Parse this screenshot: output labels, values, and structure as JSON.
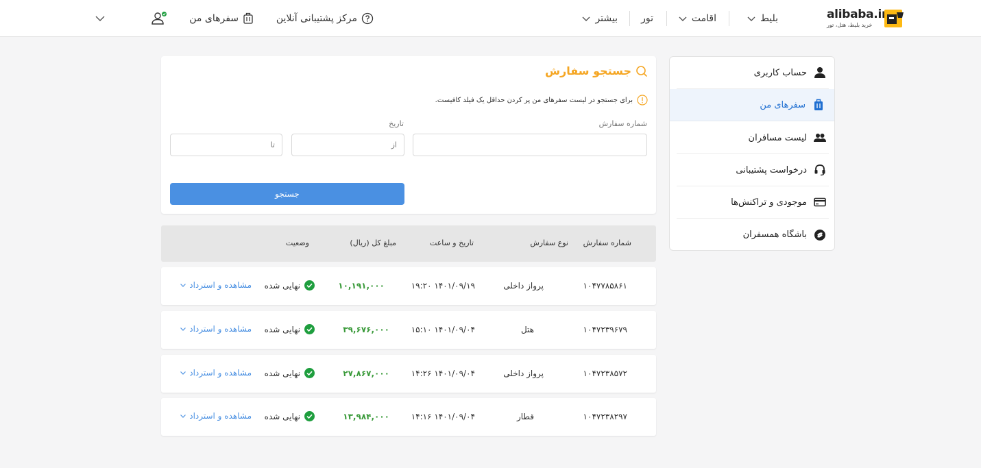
{
  "header": {
    "logo_text": "alibaba.ir",
    "logo_sub": "خرید بلیط، هتل، تور",
    "nav": {
      "ticket": "بلیط",
      "stay": "اقامت",
      "tour": "تور",
      "more": "بیشتر",
      "support": "مرکز پشتیبانی آنلاین",
      "my_trips": "سفرهای من"
    }
  },
  "sidebar": {
    "items": [
      {
        "label": "حساب کاربری",
        "icon": "user-icon"
      },
      {
        "label": "سفرهای من",
        "icon": "suitcase-icon"
      },
      {
        "label": "لیست مسافران",
        "icon": "users-icon"
      },
      {
        "label": "درخواست پشتیبانی",
        "icon": "headset-icon"
      },
      {
        "label": "موجودی و تراکنش‌ها",
        "icon": "card-icon"
      },
      {
        "label": "باشگاه همسفران",
        "icon": "club-icon"
      }
    ]
  },
  "search": {
    "title": "جستجو سفارش",
    "info": "برای جستجو در لیست سفرهای من پر کردن حداقل یک فیلد کافیست.",
    "order_label": "شماره سفارش",
    "date_label": "تاریخ",
    "from_placeholder": "از",
    "to_placeholder": "تا",
    "button": "جستجو"
  },
  "table": {
    "headers": [
      "شماره سفارش",
      "نوع سفارش",
      "تاریخ و ساعت",
      "مبلغ کل (ریال)",
      "وضعیت"
    ],
    "rows": [
      {
        "order": "۱۰۴۷۷۸۵۸۶۱",
        "type": "پرواز داخلی",
        "date": "۱۴۰۱/۰۹/۱۹  ۱۹:۲۰",
        "amount": "۱۰,۱۹۱,۰۰۰",
        "status": "نهایی شده",
        "action": "مشاهده و استرداد"
      },
      {
        "order": "۱۰۴۷۲۳۹۶۷۹",
        "type": "هتل",
        "date": "۱۴۰۱/۰۹/۰۴  ۱۵:۱۰",
        "amount": "۳۹,۶۷۶,۰۰۰",
        "status": "نهایی شده",
        "action": "مشاهده و استرداد"
      },
      {
        "order": "۱۰۴۷۲۳۸۵۷۲",
        "type": "پرواز داخلی",
        "date": "۱۴۰۱/۰۹/۰۴  ۱۴:۲۶",
        "amount": "۲۷,۸۶۷,۰۰۰",
        "status": "نهایی شده",
        "action": "مشاهده و استرداد"
      },
      {
        "order": "۱۰۴۷۲۳۸۲۹۷",
        "type": "قطار",
        "date": "۱۴۰۱/۰۹/۰۴  ۱۴:۱۶",
        "amount": "۱۳,۹۸۴,۰۰۰",
        "status": "نهایی شده",
        "action": "مشاهده و استرداد"
      }
    ]
  },
  "colors": {
    "accent": "#f5a623",
    "primary": "#4a90e2",
    "success": "#1e9e3e"
  }
}
